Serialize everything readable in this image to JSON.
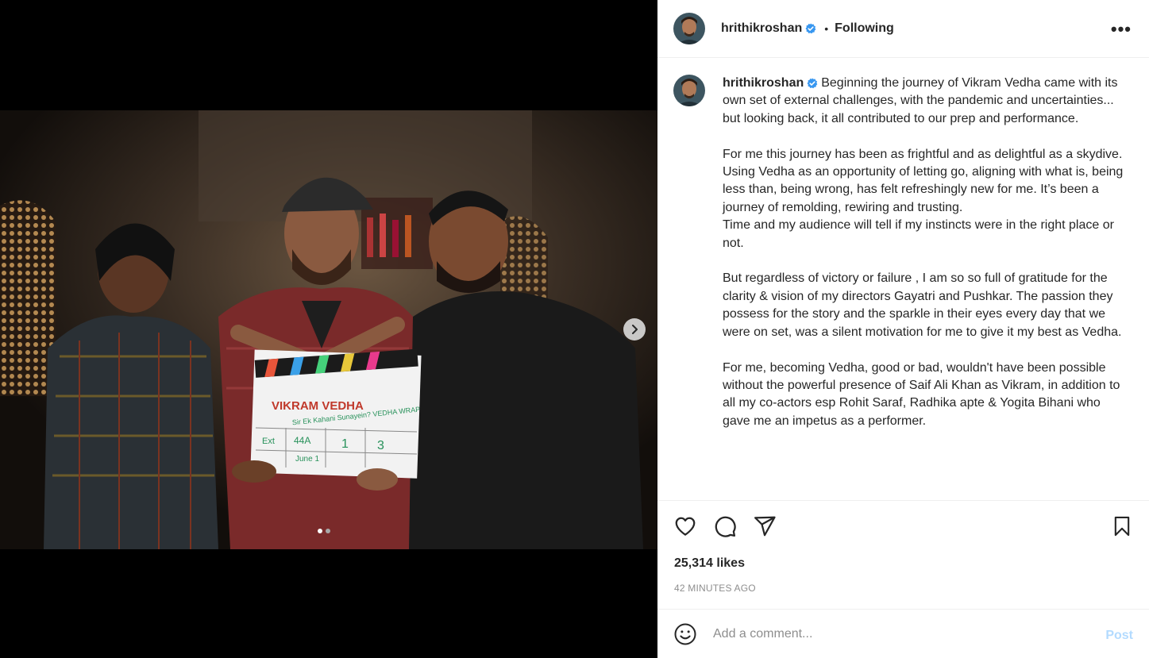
{
  "post": {
    "username": "hrithikroshan",
    "separator": "•",
    "follow_status": "Following",
    "more_label": "•••",
    "caption": "Beginning the journey of Vikram Vedha came with its own set of external challenges, with the pandemic and uncertainties... but looking back, it all contributed to our prep and performance.\n\nFor me this journey has been as frightful and as delightful as a skydive. Using Vedha as an opportunity of letting go, aligning with what is, being less than, being wrong, has felt refreshingly new for me. It’s been a journey of remolding, rewiring and trusting.\nTime and my audience will tell if my instincts were in the right place or not.\n\nBut regardless of victory or failure , I am so so full of gratitude for the clarity & vision of my directors Gayatri and Pushkar. The passion they possess for the story and the sparkle in their eyes every day that we were on set, was a silent motivation for me to give it my best as Vedha.\n\nFor me, becoming Vedha, good or bad, wouldn't have been possible without the powerful presence of Saif Ali Khan as Vikram, in addition to all my co-actors esp Rohit Saraf, Radhika apte & Yogita Bihani who gave me an impetus as a performer.",
    "likes": "25,314 likes",
    "timestamp": "42 MINUTES AGO"
  },
  "clapboard": {
    "title": "VIKRAM VEDHA",
    "handwritten": "Sir Ek Kahani Sunayein? VEDHA WRAP",
    "int_ext": "Ext",
    "scene": "44A",
    "shot": "1",
    "take": "3",
    "date": "June 1"
  },
  "carousel": {
    "total": 2,
    "current": 1
  },
  "comment": {
    "placeholder": "Add a comment...",
    "post_label": "Post"
  },
  "icons": [
    "verified-badge-icon",
    "more-options-icon",
    "heart-icon",
    "comment-icon",
    "share-icon",
    "bookmark-icon",
    "emoji-icon",
    "chevron-right-icon"
  ],
  "colors": {
    "verified": "#3897f0",
    "post_disabled": "#b3dbff",
    "muted": "#8e8e8e"
  }
}
